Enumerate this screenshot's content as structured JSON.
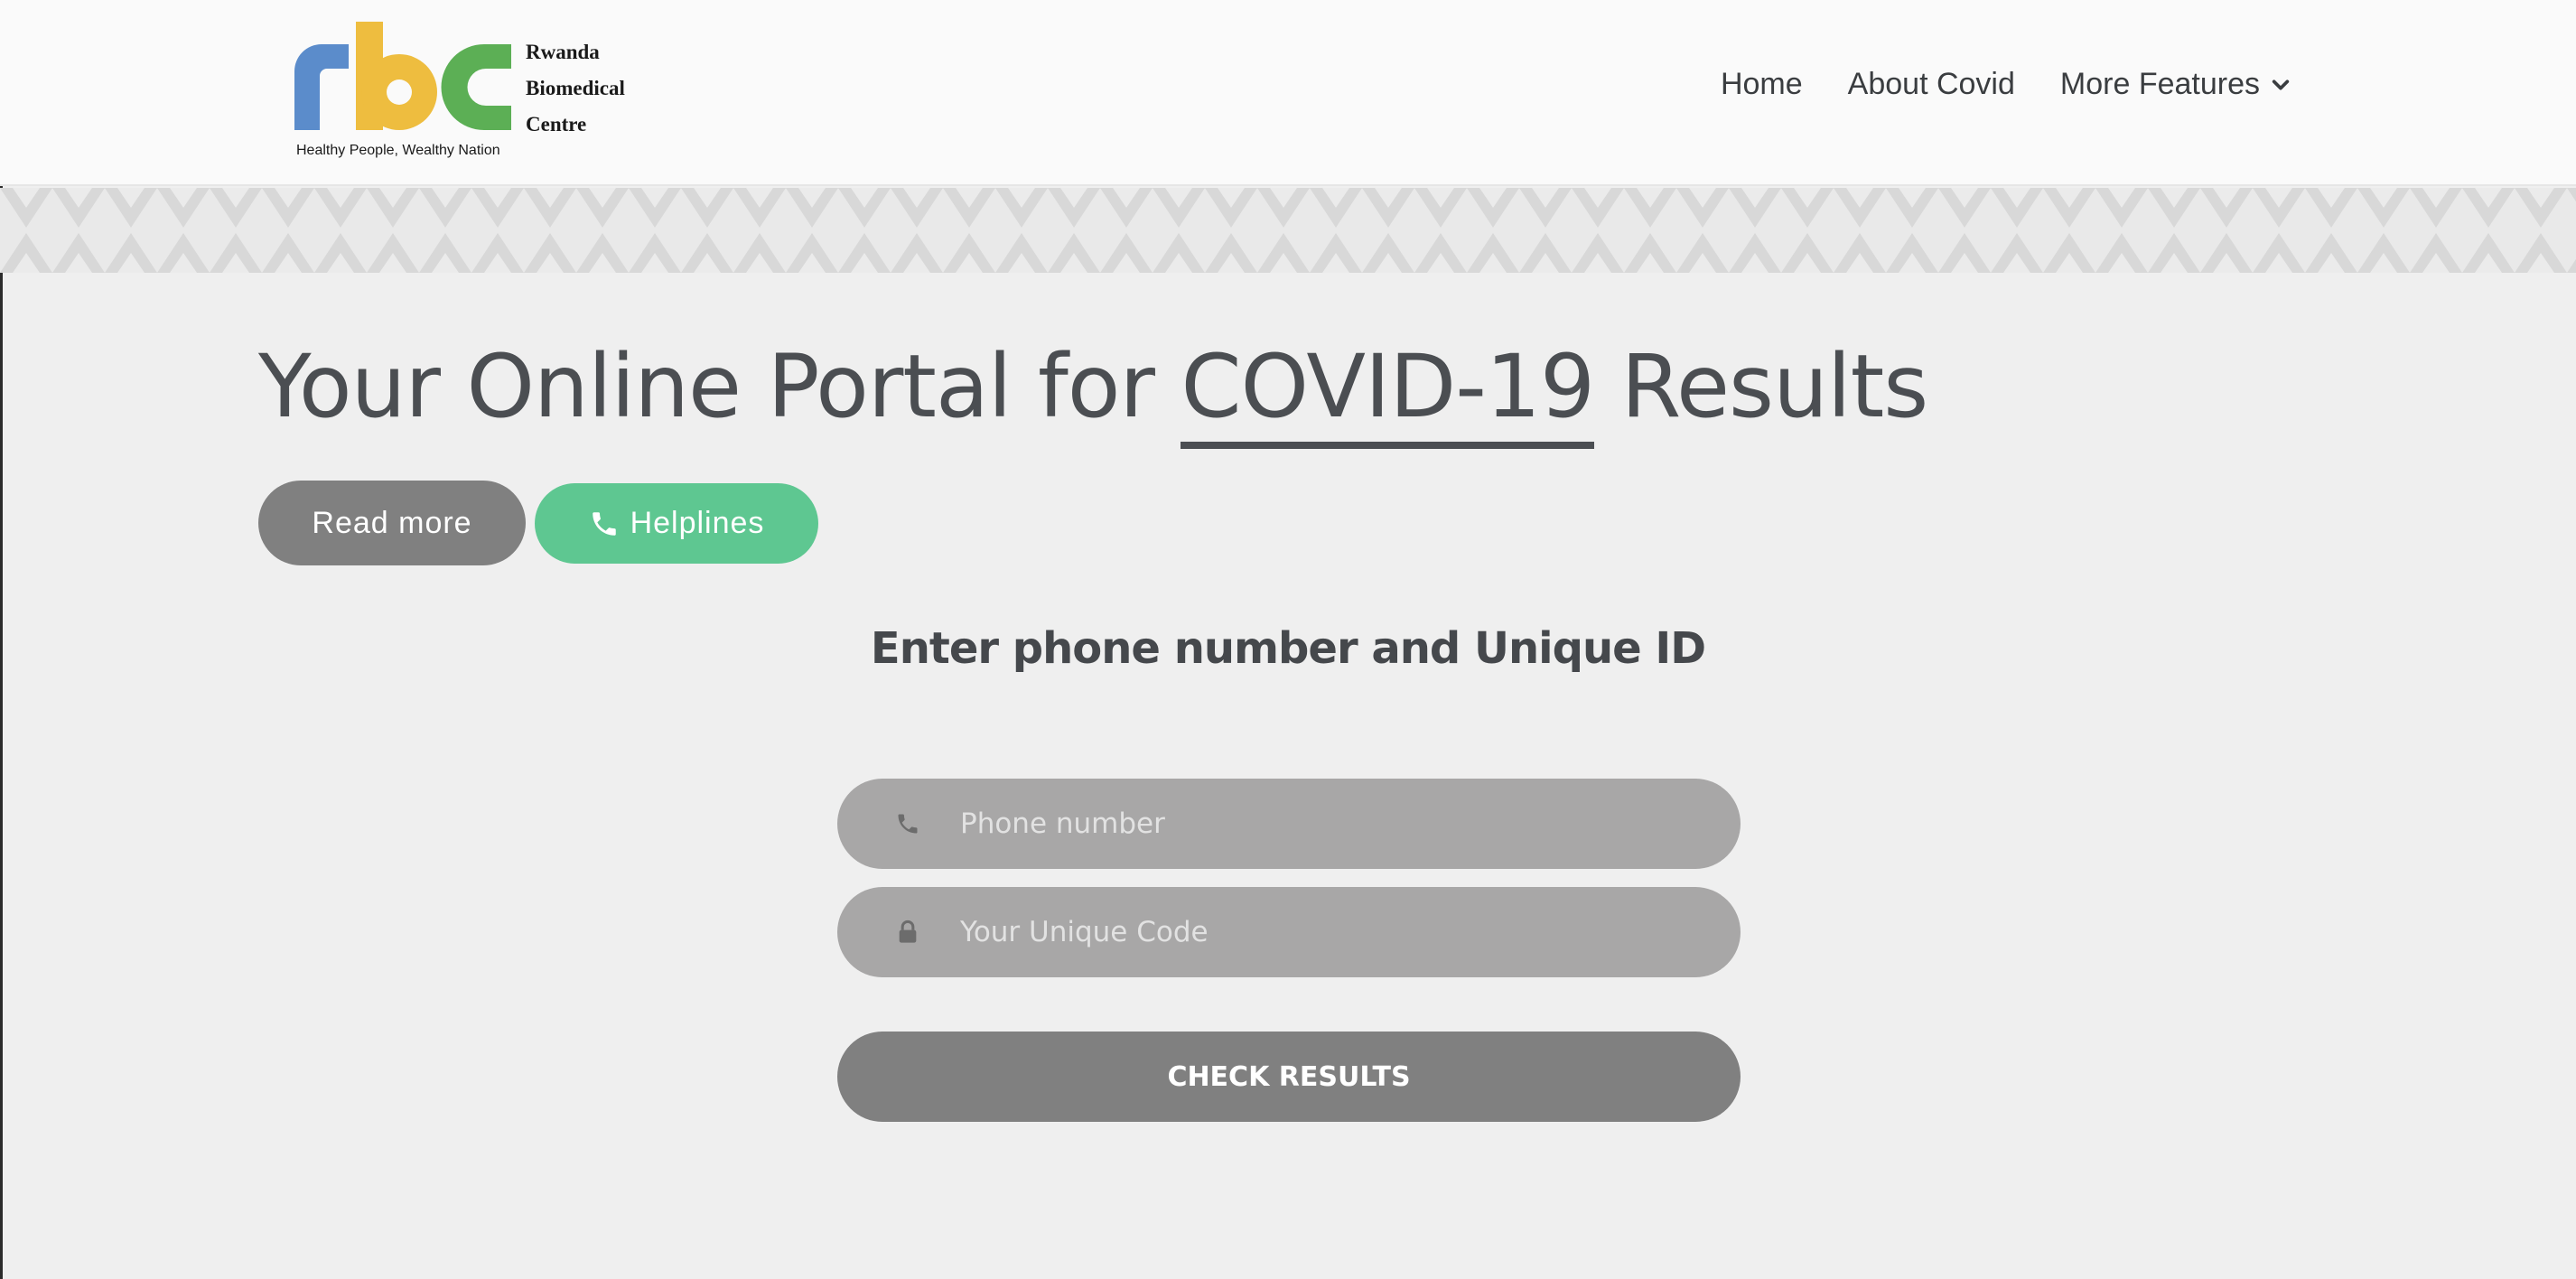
{
  "brand": {
    "name_lines": [
      "Rwanda",
      "Biomedical",
      "Centre"
    ],
    "tagline": "Healthy People, Wealthy Nation",
    "colors": {
      "r": "#5b8ccb",
      "b": "#eebd3f",
      "c": "#5caf55"
    }
  },
  "nav": {
    "home": "Home",
    "about": "About Covid",
    "more": "More Features"
  },
  "hero": {
    "title_prefix": "Your Online Portal for ",
    "title_highlight": "COVID-19",
    "title_suffix": " Results",
    "read_more": "Read more",
    "helplines": "Helplines"
  },
  "form": {
    "title": "Enter phone number and Unique ID",
    "phone_placeholder": "Phone number",
    "code_placeholder": "Your Unique Code",
    "submit": "CHECK RESULTS"
  },
  "colors": {
    "accent_green": "#5ec791",
    "button_gray": "#808080",
    "field_gray": "#a8a7a7"
  }
}
